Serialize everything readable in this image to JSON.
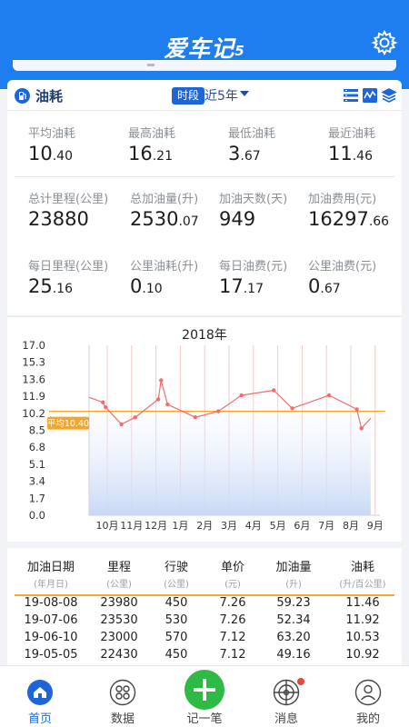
{
  "app": {
    "logo": "爱车记",
    "logo_version": "5",
    "settings_icon": "gear-icon"
  },
  "section": {
    "title": "油耗",
    "period_tag": "时段",
    "period_value": "近5年"
  },
  "stats": [
    {
      "label": "平均油耗",
      "int": "10",
      "dec": ".40"
    },
    {
      "label": "最高油耗",
      "int": "16",
      "dec": ".21"
    },
    {
      "label": "最低油耗",
      "int": "3",
      "dec": ".67"
    },
    {
      "label": "最近油耗",
      "int": "11",
      "dec": ".46"
    },
    {
      "label": "总计里程(公里)",
      "int": "23880",
      "dec": ""
    },
    {
      "label": "总加油量(升)",
      "int": "2530",
      "dec": ".07"
    },
    {
      "label": "加油天数(天)",
      "int": "949",
      "dec": ""
    },
    {
      "label": "加油费用(元)",
      "int": "16297",
      "dec": ".66"
    },
    {
      "label": "每日里程(公里)",
      "int": "25",
      "dec": ".16"
    },
    {
      "label": "公里油耗(升)",
      "int": "0",
      "dec": ".10"
    },
    {
      "label": "每日油费(元)",
      "int": "17",
      "dec": ".17"
    },
    {
      "label": "公里油费(元)",
      "int": "0",
      "dec": ".67"
    }
  ],
  "chart_data": {
    "type": "line",
    "title": "2018年",
    "yticks": [
      "17.0",
      "15.3",
      "13.6",
      "11.9",
      "10.2",
      "8.5",
      "6.8",
      "5.1",
      "3.4",
      "1.7",
      "0.0"
    ],
    "ylim": [
      0,
      17
    ],
    "xticks": [
      "10月",
      "11月",
      "12月",
      "1月",
      "2月",
      "3月",
      "4月",
      "5月",
      "6月",
      "7月",
      "8月",
      "9月"
    ],
    "points": [
      [
        0,
        11.8
      ],
      [
        1.5,
        11.3
      ],
      [
        1.8,
        10.8
      ],
      [
        3.5,
        9.1
      ],
      [
        5,
        9.8
      ],
      [
        7.5,
        11.6
      ],
      [
        7.8,
        13.5
      ],
      [
        8.5,
        11.1
      ],
      [
        11.5,
        9.8
      ],
      [
        14,
        10.4
      ],
      [
        16.5,
        12
      ],
      [
        20,
        12.5
      ],
      [
        22,
        10.7
      ],
      [
        26,
        12
      ],
      [
        29,
        10.6
      ],
      [
        29.5,
        8.7
      ],
      [
        30.5,
        9.7
      ]
    ],
    "average_label": "平均10.40",
    "average": 10.4,
    "colors": {
      "line": "#f26d6d",
      "average": "#f4a52a",
      "fill": "#c8d8f6"
    }
  },
  "table": {
    "headers": [
      {
        "h1": "加油日期",
        "h2": "(年月日)"
      },
      {
        "h1": "里程",
        "h2": "(公里)"
      },
      {
        "h1": "行驶",
        "h2": "(公里)"
      },
      {
        "h1": "单价",
        "h2": "(元)"
      },
      {
        "h1": "加油量",
        "h2": "(升)"
      },
      {
        "h1": "油耗",
        "h2": "(升/百公里)"
      }
    ],
    "rows": [
      [
        "19-08-08",
        "23980",
        "450",
        "7.26",
        "59.23",
        "11.46"
      ],
      [
        "19-07-06",
        "23530",
        "530",
        "7.26",
        "52.34",
        "11.92"
      ],
      [
        "19-06-10",
        "23000",
        "570",
        "7.12",
        "63.20",
        "10.53"
      ],
      [
        "19-05-05",
        "22430",
        "450",
        "7.12",
        "49.16",
        "10.92"
      ]
    ]
  },
  "tabs": [
    {
      "label": "首页",
      "icon": "home-icon"
    },
    {
      "label": "数据",
      "icon": "grid-icon"
    },
    {
      "label": "记一笔",
      "icon": "plus-icon"
    },
    {
      "label": "消息",
      "icon": "radar-icon"
    },
    {
      "label": "我的",
      "icon": "person-icon"
    }
  ]
}
